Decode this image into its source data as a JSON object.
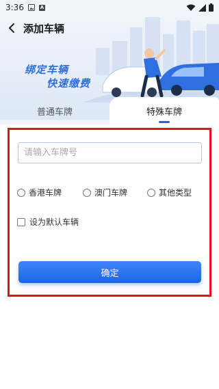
{
  "status_bar": {
    "time": "3:36",
    "icon_a_label": "A"
  },
  "header": {
    "title": "添加车辆"
  },
  "banner": {
    "line1": "绑定车辆",
    "line2": "快速缴费"
  },
  "tabs": [
    {
      "label": "普通车牌",
      "selected": false
    },
    {
      "label": "特殊车牌",
      "selected": true
    }
  ],
  "form": {
    "plate_placeholder": "请输入车牌号",
    "plate_value": "",
    "plate_types": [
      "香港车牌",
      "澳门车牌",
      "其他类型"
    ],
    "default_label": "设为默认车辆",
    "confirm_label": "确定"
  },
  "colors": {
    "accent": "#1b66e8",
    "highlight": "#e0121b",
    "slogan": "#2f6fe0"
  },
  "icons": [
    "back-arrow-icon",
    "wifi-icon",
    "signal-icon",
    "battery-icon",
    "image-icon",
    "notification-a-icon"
  ]
}
